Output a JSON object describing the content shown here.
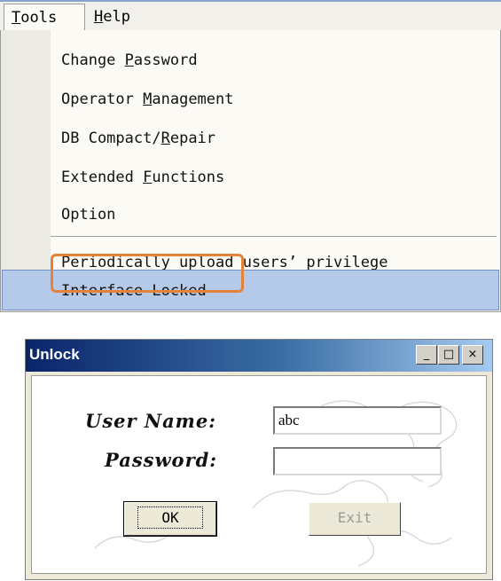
{
  "menubar": {
    "tools_label": "Tools",
    "tools_mnemonic": "T",
    "tools_rest": "ools",
    "help_mnemonic": "H",
    "help_rest": "elp"
  },
  "tools_menu": {
    "items": [
      {
        "before": "Change ",
        "mnemonic": "P",
        "after": "assword"
      },
      {
        "before": "Operator ",
        "mnemonic": "M",
        "after": "anagement"
      },
      {
        "before": "DB Compact/",
        "mnemonic": "R",
        "after": "epair"
      },
      {
        "before": "Extended ",
        "mnemonic": "F",
        "after": "unctions"
      },
      {
        "before": "Option",
        "mnemonic": "",
        "after": ""
      },
      {
        "before": "Periodically upload users’ privilege",
        "mnemonic": "",
        "after": ""
      },
      {
        "before": "Interface Locked",
        "mnemonic": "",
        "after": ""
      }
    ],
    "highlighted_item": "Interface Locked",
    "highlight_color": "#b5c9e8",
    "callout_color": "#e4823a"
  },
  "unlock_dialog": {
    "title": "Unlock",
    "user_name_label": "User Name:",
    "user_name_value": "abc",
    "password_label": "Password:",
    "password_value": "",
    "ok_label": "OK",
    "exit_label": "Exit",
    "title_bar_color": "#0a246a",
    "window_buttons": {
      "minimize": "_",
      "maximize": "□",
      "close": "×"
    }
  }
}
